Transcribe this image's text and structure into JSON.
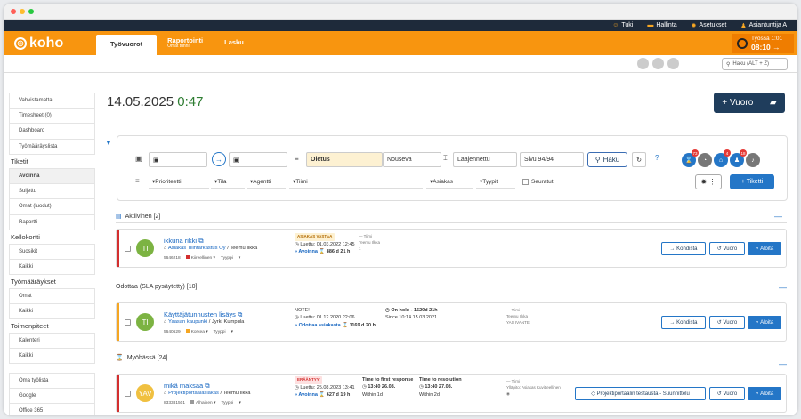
{
  "topbar": {
    "items": [
      {
        "icon": "help-icon",
        "label": "Tuki"
      },
      {
        "icon": "admin-icon",
        "label": "Hallinta"
      },
      {
        "icon": "gear-icon",
        "label": "Asetukset"
      },
      {
        "icon": "user-icon",
        "label": "Asiantuntija A"
      }
    ]
  },
  "brand": {
    "logo": "koho",
    "color": "#f8950f"
  },
  "nav": {
    "tabs": [
      {
        "label": "Työvuorot",
        "sub": ""
      },
      {
        "label": "Raportointi",
        "sub": "Omat tunnit"
      },
      {
        "label": "Lasku",
        "sub": ""
      }
    ]
  },
  "clock": {
    "status": "Työssä",
    "time_small": "1:01",
    "time": "08:10 →"
  },
  "search": {
    "placeholder": "Haku (ALT + Z)"
  },
  "sidebar": {
    "top": [
      "Vahvistamatta",
      "Timesheet (0)",
      "Dashboard",
      "Työmääräyslista"
    ],
    "sections": [
      {
        "title": "Tiketit",
        "items": [
          "Avoinna",
          "Suljettu",
          "Omat (luodut)",
          "Raportti"
        ]
      },
      {
        "title": "Kellokortti",
        "items": [
          "Suosikit",
          "Kaikki"
        ]
      },
      {
        "title": "Työmääräykset",
        "items": [
          "Omat",
          "Kaikki"
        ]
      },
      {
        "title": "Toimenpiteet",
        "items": [
          "Kalenteri",
          "Kaikki"
        ]
      }
    ],
    "bottom": [
      "Oma työlista",
      "Google",
      "Office 365"
    ]
  },
  "main": {
    "date": "14.05.2025",
    "time": "0:47",
    "vuoro_btn": "+ Vuoro"
  },
  "filter": {
    "preset": "Oletus",
    "order": "Nouseva",
    "scope": "Laajennettu",
    "page": "Sivu 94/94",
    "haku": "Haku",
    "selects": [
      "Prioriteetti",
      "Tila",
      "Agentti",
      "Tiimi",
      "Asiakas",
      "Tyypit"
    ],
    "seuratut": "Seuratut",
    "tiketti_btn": "+ Tiketti",
    "badges": [
      "73",
      "",
      "4",
      "18",
      ""
    ]
  },
  "sections": [
    {
      "title": "Aktiivinen [2]"
    },
    {
      "title": "Odottaa (SLA pysäytetty) [10]"
    },
    {
      "title": "Myöhässä [24]"
    }
  ],
  "tickets": [
    {
      "initials": "TI",
      "color": "#7cb342",
      "stripe": "#d32f2f",
      "title": "ikkuna rikki",
      "customer": "Asiakas Tilintarkastus Oy",
      "person": "Teemu Ilkka",
      "id": "5646218",
      "priority": "Kiireellinen",
      "type": "Tyyppi",
      "tag": "ASIAKAS VASTAA",
      "read": "Luettu: 01.03.2022 12:45",
      "state": "Avoinna",
      "age": "886 d 21 h",
      "c2a": "— Tiimi",
      "c2b": "Teemu Ilkka",
      "c2c": "1",
      "act1": "→ Kohdista",
      "act2": "Vuoro",
      "act3": "Aloita"
    },
    {
      "initials": "TI",
      "color": "#7cb342",
      "stripe": "#f5a623",
      "title": "Käyttäjätunnusten lisäys",
      "customer": "Yaasan kaupunki",
      "person": "Jyrki Kumpula",
      "id": "5640629",
      "priority": "Korkea",
      "type": "Tyyppi",
      "tag": "NOTE!",
      "read": "Luettu: 01.12.2020 22:06",
      "state": "Odottaa asiakasta",
      "age": "1169 d 20 h",
      "hold": "On hold - 1520d 21h",
      "since": "Since 10:14 15.03.2021",
      "c2a": "— Tiimi",
      "c2b": "Teemu Ilkka",
      "c2c": "YAS IVANTE",
      "act1": "→ Kohdista",
      "act2": "Vuoro",
      "act3": "Aloita"
    },
    {
      "initials": "YAV",
      "color": "#f0c040",
      "stripe": "#d32f2f",
      "title": "mikä maksaa",
      "customer": "Projektiportaalasiakas",
      "person": "Teemu Ilkka",
      "id": "833381501",
      "priority": "Alhainen",
      "type": "Tyyppi",
      "tag": "ERÄÄNTYY",
      "read": "Luettu: 25.08.2023 13:41",
      "state": "Avoinna",
      "age": "627 d 19 h",
      "ttfr_label": "Time to first response",
      "ttfr": "13:40 26.08.",
      "ttfr_w": "Within 1d",
      "ttr_label": "Time to resolution",
      "ttr": "13:40 27.08.",
      "ttr_w": "Within 2d",
      "c2a": "— Tiimi",
      "c2b": "Ylläpito: Asiakas Kuvitteellinen",
      "c2c": "",
      "act1": "Projektiportaalin testausta - Suunnittelu",
      "act2": "Vuoro",
      "act3": "Aloita"
    }
  ]
}
